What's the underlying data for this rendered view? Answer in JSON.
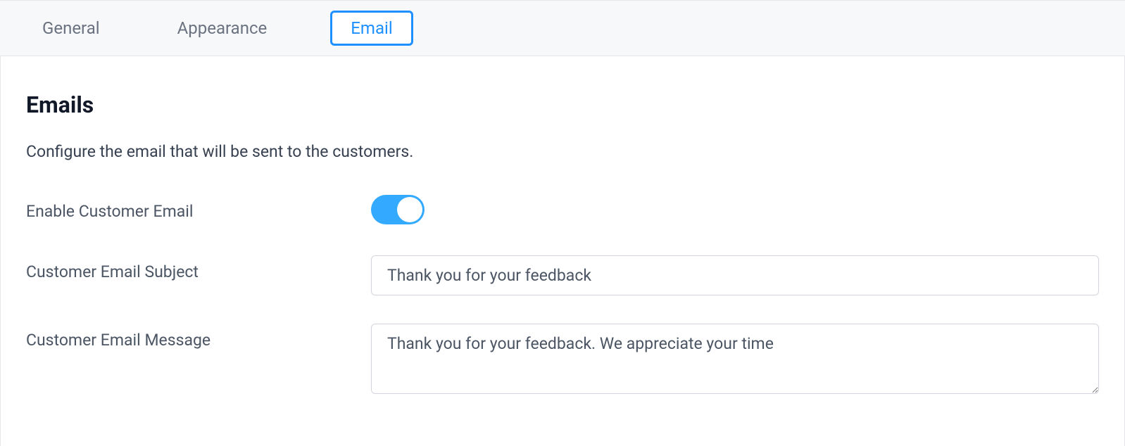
{
  "tabs": {
    "general": "General",
    "appearance": "Appearance",
    "email": "Email"
  },
  "section": {
    "title": "Emails",
    "description": "Configure the email that will be sent to the customers."
  },
  "form": {
    "enable_label": "Enable Customer Email",
    "enable_state": "on",
    "subject_label": "Customer Email Subject",
    "subject_value": "Thank you for your feedback",
    "message_label": "Customer Email Message",
    "message_value": "Thank you for your feedback. We appreciate your time"
  }
}
